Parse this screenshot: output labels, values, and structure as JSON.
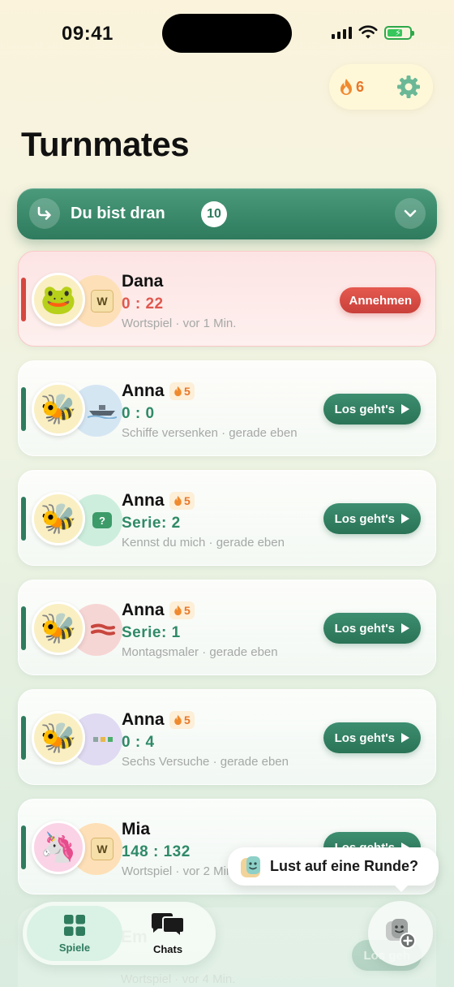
{
  "status_bar": {
    "time": "09:41"
  },
  "header": {
    "streak_count": "6",
    "title": "Turnmates"
  },
  "turn_bar": {
    "label": "Du bist dran",
    "count": "10"
  },
  "cards": [
    {
      "player": "Dana",
      "avatar": "🐸",
      "score": "0 : 22",
      "meta": "Wortspiel · vor 1 Min.",
      "action": "Annehmen",
      "game_icon": "letter-tile-icon",
      "game_tile": "W"
    },
    {
      "player": "Anna",
      "avatar": "🐝",
      "streak": "5",
      "score": "0 : 0",
      "meta": "Schiffe versenken · gerade eben",
      "action": "Los geht's",
      "game_icon": "ship-icon"
    },
    {
      "player": "Anna",
      "avatar": "🐝",
      "streak": "5",
      "score": "Serie: 2",
      "meta": "Kennst du mich · gerade eben",
      "action": "Los geht's",
      "game_icon": "question-bubble-icon",
      "game_tile": "?"
    },
    {
      "player": "Anna",
      "avatar": "🐝",
      "streak": "5",
      "score": "Serie: 1",
      "meta": "Montagsmaler · gerade eben",
      "action": "Los geht's",
      "game_icon": "brush-stroke-icon"
    },
    {
      "player": "Anna",
      "avatar": "🐝",
      "streak": "5",
      "score": "0 : 4",
      "meta": "Sechs Versuche · gerade eben",
      "action": "Los geht's",
      "game_icon": "letter-grid-icon"
    },
    {
      "player": "Mia",
      "avatar": "🦄",
      "score": "148 : 132",
      "meta": "Wortspiel · vor 2 Min.",
      "action": "Los geht's",
      "game_icon": "letter-tile-icon",
      "game_tile": "W"
    }
  ],
  "faded_card": {
    "player": "Em",
    "meta": "Wortspiel · vor 4 Min.",
    "action": "Los geh"
  },
  "tooltip": {
    "text": "Lust auf eine Runde?"
  },
  "tabs": {
    "games": "Spiele",
    "chats": "Chats"
  },
  "colors": {
    "accent": "#2f7c5f",
    "accept": "#d6473f",
    "streak": "#e8762a"
  }
}
